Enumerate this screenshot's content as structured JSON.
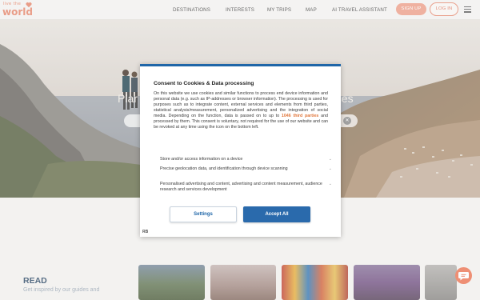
{
  "logo": {
    "line1": "live the",
    "line2": "world"
  },
  "nav": {
    "items": [
      "DESTINATIONS",
      "INTERESTS",
      "MY TRIPS",
      "MAP",
      "AI TRAVEL ASSISTANT"
    ],
    "signup": "SIGN UP",
    "login": "LOG IN"
  },
  "hero": {
    "title_left": "Plar",
    "title_right": "nces"
  },
  "read": {
    "title": "READ",
    "subtitle": "Get inspired by our guides and"
  },
  "consent": {
    "title": "Consent to Cookies & Data processing",
    "body_before": "On this website we use cookies and similar functions to process end device information and personal data (e.g. such as IP-addresses or browser information). The processing is used for purposes such as to integrate content, external services and elements from third parties, statistical analysis/measurement, personalized advertising and the integration of social media. Depending on the function, data is passed on to up to ",
    "third_parties": "1046 third parties",
    "body_after": " and processed by them. This consent is voluntary, not required for the use of our website and can be revoked at any time using the icon on the bottom left.",
    "options": [
      "Store and/or access information on a device",
      "Precise geolocation data, and identification through device scanning",
      "Personalised advertising and content, advertising and content measurement, audience research and services development"
    ],
    "settings_label": "Settings",
    "accept_label": "Accept All",
    "badge": "RB"
  },
  "colors": {
    "accent": "#e88b72",
    "primary_blue": "#2a6aac",
    "read_title": "#35516d"
  }
}
